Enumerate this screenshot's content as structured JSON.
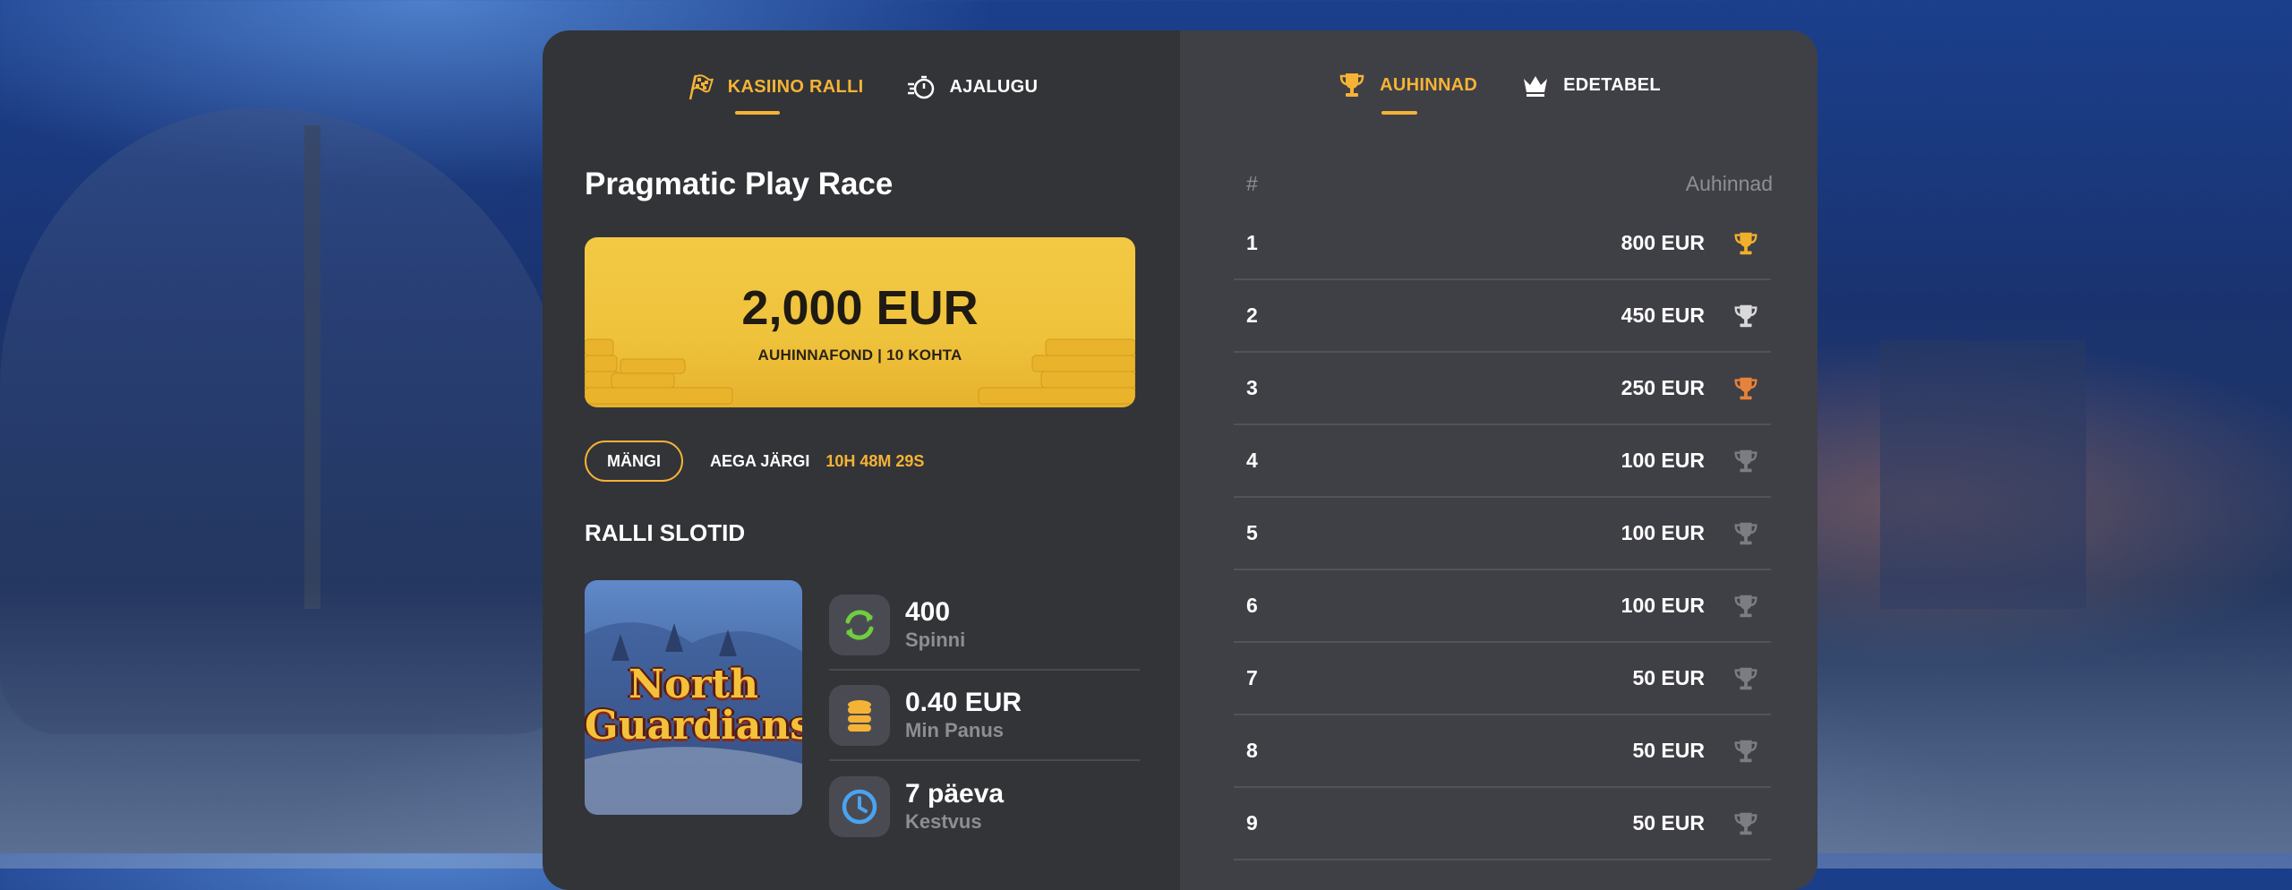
{
  "left_tabs": [
    {
      "label": "KASIINO RALLI",
      "icon": "checkered-flag-icon",
      "active": true
    },
    {
      "label": "AJALUGU",
      "icon": "stopwatch-icon",
      "active": false
    }
  ],
  "right_tabs": [
    {
      "label": "AUHINNAD",
      "icon": "trophy-icon",
      "active": true
    },
    {
      "label": "EDETABEL",
      "icon": "crown-icon",
      "active": false
    }
  ],
  "race": {
    "title": "Pragmatic Play Race",
    "prize_pool": "2,000 EUR",
    "prize_sub": "AUHINNAFOND | 10 KOHTA",
    "play_button": "MÄNGI",
    "time_left_label": "AEGA JÄRGI",
    "time_left_value": "10H 48M 29S"
  },
  "slots": {
    "section_title": "RALLI SLOTID",
    "game_title_line1": "North",
    "game_title_line2": "Guardians",
    "stats": [
      {
        "value": "400",
        "label": "Spinni",
        "icon": "refresh-icon"
      },
      {
        "value": "0.40 EUR",
        "label": "Min Panus",
        "icon": "coins-icon"
      },
      {
        "value": "7 päeva",
        "label": "Kestvus",
        "icon": "clock-icon"
      }
    ]
  },
  "prizes": {
    "header_rank": "#",
    "header_prize": "Auhinnad",
    "rows": [
      {
        "rank": "1",
        "prize": "800 EUR",
        "trophy": "gold"
      },
      {
        "rank": "2",
        "prize": "450 EUR",
        "trophy": "silver"
      },
      {
        "rank": "3",
        "prize": "250 EUR",
        "trophy": "bronze"
      },
      {
        "rank": "4",
        "prize": "100 EUR",
        "trophy": "grey"
      },
      {
        "rank": "5",
        "prize": "100 EUR",
        "trophy": "grey"
      },
      {
        "rank": "6",
        "prize": "100 EUR",
        "trophy": "grey"
      },
      {
        "rank": "7",
        "prize": "50 EUR",
        "trophy": "grey"
      },
      {
        "rank": "8",
        "prize": "50 EUR",
        "trophy": "grey"
      },
      {
        "rank": "9",
        "prize": "50 EUR",
        "trophy": "grey"
      }
    ]
  },
  "colors": {
    "accent": "#f5b335",
    "gold": "#f0b02c",
    "silver": "#d9d9dc",
    "bronze": "#e8823a",
    "grey": "#7c7d83"
  }
}
